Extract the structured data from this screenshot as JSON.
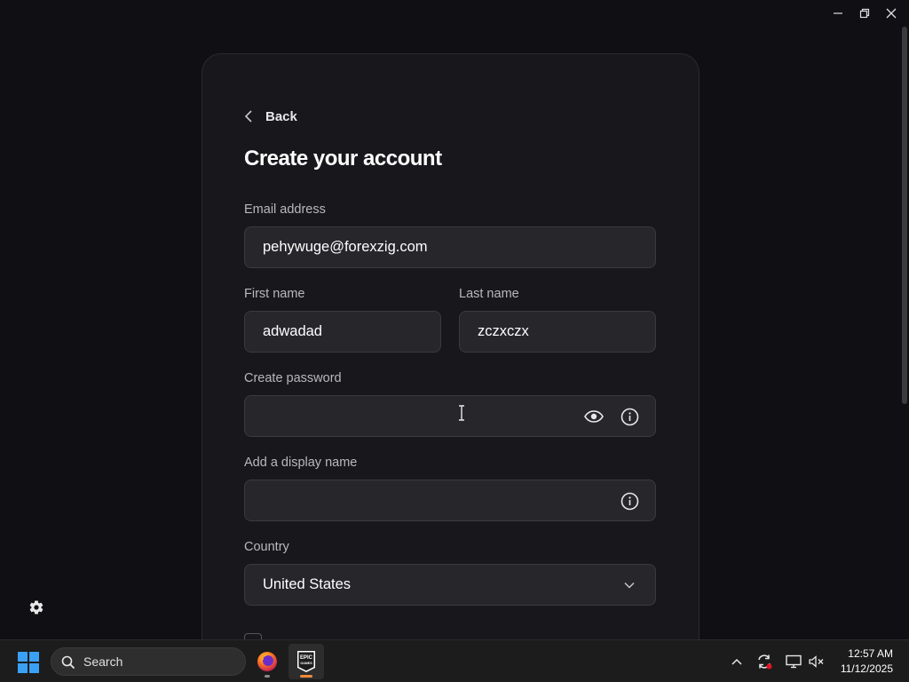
{
  "window": {
    "minimize_icon": "minimize-icon",
    "restore_icon": "restore-icon",
    "close_icon": "close-icon"
  },
  "form": {
    "back_label": "Back",
    "title": "Create your account",
    "email": {
      "label": "Email address",
      "value": "pehywuge@forexzig.com"
    },
    "first_name": {
      "label": "First name",
      "value": "adwadad"
    },
    "last_name": {
      "label": "Last name",
      "value": "zczxczx"
    },
    "password": {
      "label": "Create password",
      "value": ""
    },
    "display_name": {
      "label": "Add a display name",
      "value": ""
    },
    "country": {
      "label": "Country",
      "value": "United States"
    }
  },
  "taskbar": {
    "search_label": "Search",
    "apps": [
      "firefox",
      "epic-games-launcher"
    ],
    "epic_logo_text": "EPIC GAMES",
    "time": "12:57 AM",
    "date": "11/12/2025"
  },
  "colors": {
    "background": "#101014",
    "card": "#18181c",
    "field": "#26262b",
    "accent_blue": "#3aa0f3",
    "epic_indicator": "#f08a3c"
  }
}
